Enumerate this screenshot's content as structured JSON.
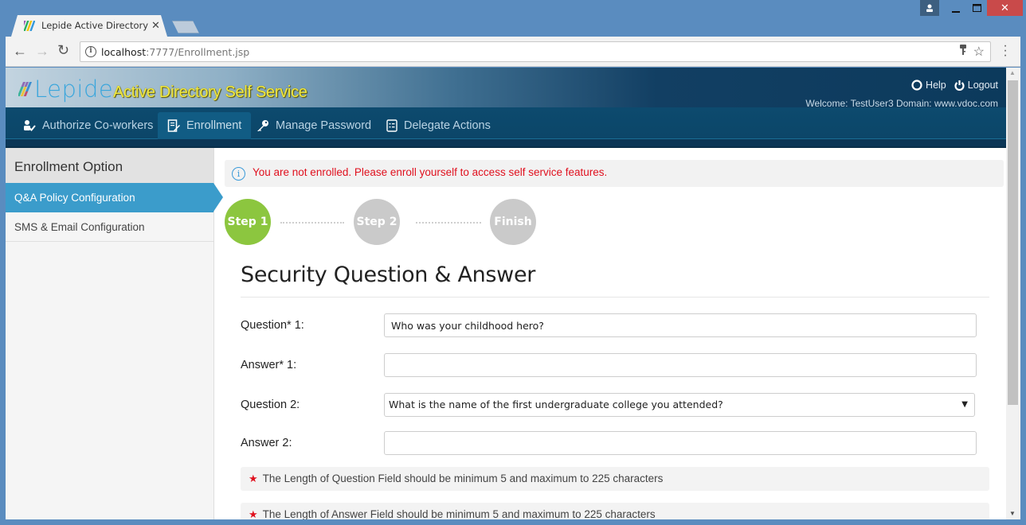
{
  "browser": {
    "tab_title": "Lepide Active Directory S",
    "url_host": "localhost",
    "url_rest": ":7777/Enrollment.jsp",
    "icons": {
      "back": "arrow-left",
      "forward": "arrow-right",
      "reload": "reload",
      "info": "info",
      "key": "key",
      "star": "star",
      "menu": "three-dots-vertical",
      "close_tab": "close",
      "user": "user",
      "minimize": "minimize",
      "maximize": "maximize",
      "close_window": "close"
    }
  },
  "header": {
    "logo_text": "Lepide",
    "app_title": "Active Directory Self Service",
    "help_label": "Help",
    "logout_label": "Logout",
    "welcome_text": "Welcome: TestUser3  Domain: www.vdoc.com"
  },
  "nav": {
    "items": [
      {
        "label": "Authorize Co-workers",
        "icon": "user-check"
      },
      {
        "label": "Enrollment",
        "icon": "document-edit",
        "active": true
      },
      {
        "label": "Manage Password",
        "icon": "key"
      },
      {
        "label": "Delegate Actions",
        "icon": "list-document"
      }
    ]
  },
  "sidebar": {
    "heading": "Enrollment Option",
    "items": [
      {
        "label": "Q&A Policy Configuration",
        "active": true
      },
      {
        "label": "SMS & Email Configuration",
        "active": false
      }
    ]
  },
  "main": {
    "alert": "You are not enrolled. Please enroll yourself to access self service features.",
    "steps": [
      {
        "label": "Step 1",
        "state": "current"
      },
      {
        "label": "Step 2",
        "state": "pending"
      },
      {
        "label": "Finish",
        "state": "pending"
      }
    ],
    "section_title": "Security Question & Answer",
    "form": {
      "question1_label": "Question* 1:",
      "question1_value": "Who was your childhood hero?",
      "answer1_label": "Answer* 1:",
      "answer1_value": "",
      "question2_label": "Question 2:",
      "question2_selected": "What is the name of the first undergraduate college you attended?",
      "answer2_label": "Answer 2:",
      "answer2_value": ""
    },
    "notes": [
      "The Length of Question Field should be minimum 5 and maximum to 225 characters",
      "The Length of Answer Field should be minimum 5 and maximum to 225 characters"
    ]
  },
  "colors": {
    "accent_blue": "#3b9ccb",
    "step_current": "#8cc63f",
    "step_pending": "#cacaca",
    "alert_text": "#e0101e",
    "title_yellow": "#f2e940",
    "nav_bg": "#0d4a6e"
  }
}
